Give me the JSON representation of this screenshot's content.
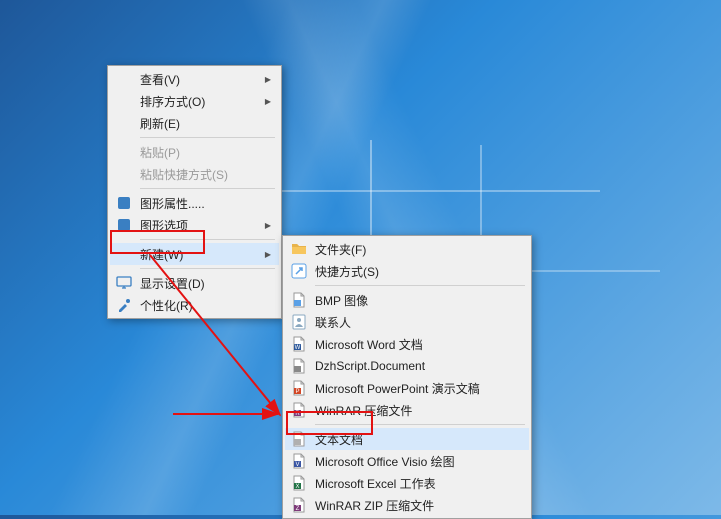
{
  "contextMenu": {
    "items": [
      {
        "label": "查看(V)",
        "hasSub": true,
        "enabled": true,
        "icon": null
      },
      {
        "label": "排序方式(O)",
        "hasSub": true,
        "enabled": true,
        "icon": null
      },
      {
        "label": "刷新(E)",
        "enabled": true,
        "icon": null
      },
      {
        "sep": true
      },
      {
        "label": "粘贴(P)",
        "enabled": false,
        "icon": null
      },
      {
        "label": "粘贴快捷方式(S)",
        "enabled": false,
        "icon": null
      },
      {
        "sep": true
      },
      {
        "label": "图形属性.....",
        "enabled": true,
        "icon": "intel"
      },
      {
        "label": "图形选项",
        "hasSub": true,
        "enabled": true,
        "icon": "intel"
      },
      {
        "sep": true
      },
      {
        "label": "新建(W)",
        "hasSub": true,
        "enabled": true,
        "icon": null,
        "highlighted": true
      },
      {
        "sep": true
      },
      {
        "label": "显示设置(D)",
        "enabled": true,
        "icon": "monitor"
      },
      {
        "label": "个性化(R)",
        "enabled": true,
        "icon": "personalize"
      }
    ]
  },
  "newSubmenu": {
    "items": [
      {
        "label": "文件夹(F)",
        "icon": "folder"
      },
      {
        "label": "快捷方式(S)",
        "icon": "shortcut"
      },
      {
        "sep": true
      },
      {
        "label": "BMP 图像",
        "icon": "bmp"
      },
      {
        "label": "联系人",
        "icon": "contact"
      },
      {
        "label": "Microsoft Word 文档",
        "icon": "word"
      },
      {
        "label": "DzhScript.Document",
        "icon": "doc"
      },
      {
        "label": "Microsoft PowerPoint 演示文稿",
        "icon": "ppt"
      },
      {
        "label": "WinRAR 压缩文件",
        "icon": "rar"
      },
      {
        "sep": true
      },
      {
        "label": "文本文档",
        "icon": "txt",
        "highlighted": true
      },
      {
        "label": "Microsoft Office Visio 绘图",
        "icon": "visio"
      },
      {
        "label": "Microsoft Excel 工作表",
        "icon": "excel"
      },
      {
        "label": "WinRAR ZIP 压缩文件",
        "icon": "zip"
      }
    ]
  },
  "icons": {
    "folder": "#f7c65d",
    "shortcut": "#5aa0e6",
    "bmp": "#5aa0e6",
    "contact": "#8aa8c0",
    "word": "#2b579a",
    "doc": "#888888",
    "ppt": "#d24726",
    "rar": "#7e3b7a",
    "txt": "#b0b0b0",
    "visio": "#3955a3",
    "excel": "#217346",
    "zip": "#7e3b7a",
    "intel": "#3a7fc2",
    "monitor": "#3a7fc2",
    "personalize": "#3a7fc2"
  }
}
